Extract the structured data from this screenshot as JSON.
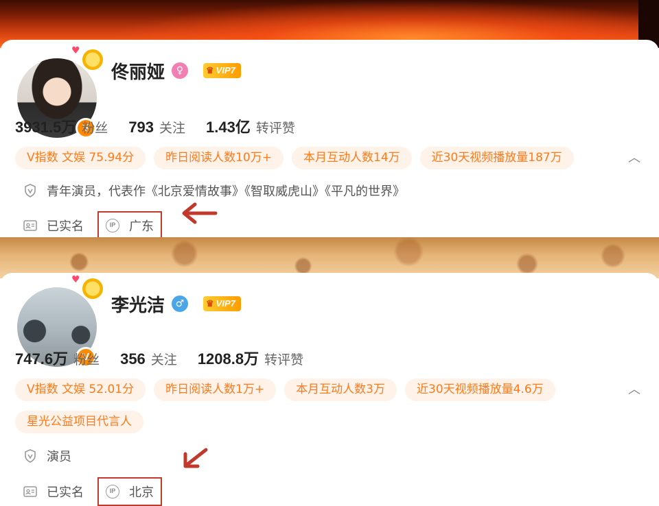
{
  "profiles": [
    {
      "name": "佟丽娅",
      "gender": "female",
      "vip_label": "VIP7",
      "avatar_badge": "V",
      "stats": [
        {
          "value": "3931.5万",
          "label": "粉丝"
        },
        {
          "value": "793",
          "label": "关注"
        },
        {
          "value": "1.43亿",
          "label": "转评赞"
        }
      ],
      "tags": [
        [
          "V指数 文娱 75.94分",
          "昨日阅读人数10万+",
          "本月互动人数14万",
          "近30天视频播放量187万"
        ]
      ],
      "description": "青年演员，代表作《北京爱情故事》《智取威虎山》《平凡的世界》",
      "verified_label": "已实名",
      "ip_label": "广东"
    },
    {
      "name": "李光洁",
      "gender": "male",
      "vip_label": "VIP7",
      "avatar_badge": "V",
      "stats": [
        {
          "value": "747.6万",
          "label": "粉丝"
        },
        {
          "value": "356",
          "label": "关注"
        },
        {
          "value": "1208.8万",
          "label": "转评赞"
        }
      ],
      "tags": [
        [
          "V指数 文娱 52.01分",
          "昨日阅读人数1万+",
          "本月互动人数3万",
          "近30天视频播放量4.6万"
        ],
        [
          "星光公益项目代言人"
        ]
      ],
      "description": "演员",
      "verified_label": "已实名",
      "ip_label": "北京"
    }
  ],
  "icons": {
    "gender_female": "♀",
    "gender_male": "♂",
    "crown": "♛",
    "collapse": "︿",
    "ip": "IP",
    "heart": "♥"
  },
  "colors": {
    "tag_bg": "#fff2e8",
    "tag_text": "#ff7a1a",
    "annotation": "#c0392b",
    "vip_gold": "#ffb300"
  }
}
